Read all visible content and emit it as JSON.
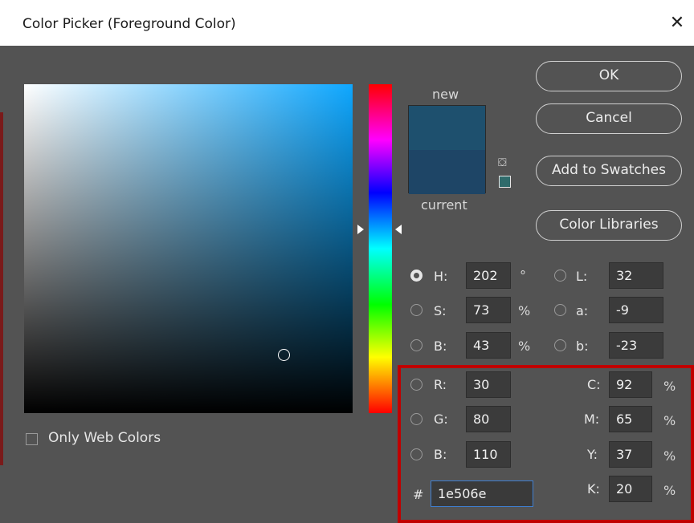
{
  "window": {
    "title": "Color Picker (Foreground Color)",
    "close_glyph": "✕"
  },
  "preview": {
    "new_label": "new",
    "current_label": "current",
    "new_color": "#1e506e",
    "current_color": "#1e4566"
  },
  "buttons": {
    "ok": "OK",
    "cancel": "Cancel",
    "add_to_swatches": "Add to Swatches",
    "color_libraries": "Color Libraries"
  },
  "hsb": {
    "h": {
      "label": "H:",
      "value": "202",
      "unit": "°",
      "selected": true
    },
    "s": {
      "label": "S:",
      "value": "73",
      "unit": "%"
    },
    "b": {
      "label": "B:",
      "value": "43",
      "unit": "%"
    }
  },
  "lab": {
    "l": {
      "label": "L:",
      "value": "32"
    },
    "a": {
      "label": "a:",
      "value": "-9"
    },
    "b": {
      "label": "b:",
      "value": "-23"
    }
  },
  "rgb": {
    "r": {
      "label": "R:",
      "value": "30"
    },
    "g": {
      "label": "G:",
      "value": "80"
    },
    "b": {
      "label": "B:",
      "value": "110"
    }
  },
  "cmyk": {
    "c": {
      "label": "C:",
      "value": "92",
      "unit": "%"
    },
    "m": {
      "label": "M:",
      "value": "65",
      "unit": "%"
    },
    "y": {
      "label": "Y:",
      "value": "37",
      "unit": "%"
    },
    "k": {
      "label": "K:",
      "value": "20",
      "unit": "%"
    }
  },
  "hex": {
    "label": "#",
    "value": "1e506e"
  },
  "only_web_colors": {
    "label": "Only Web Colors",
    "checked": false
  },
  "colors": {
    "highlight": "#c00000",
    "panel": "#535353"
  }
}
